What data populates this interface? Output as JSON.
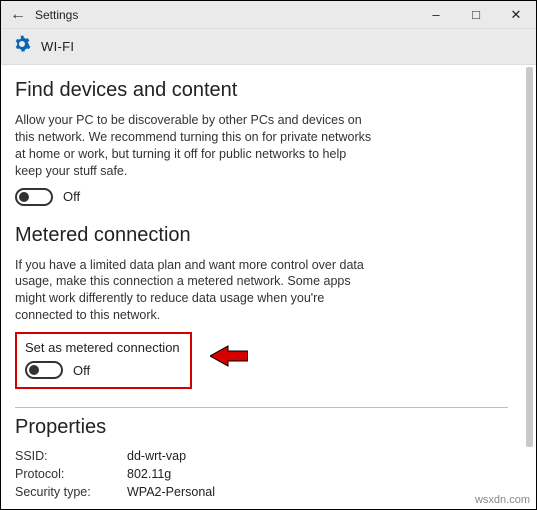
{
  "window": {
    "title": "Settings",
    "page": "WI-FI"
  },
  "sections": {
    "find": {
      "heading": "Find devices and content",
      "desc": "Allow your PC to be discoverable by other PCs and devices on this network. We recommend turning this on for private networks at home or work, but turning it off for public networks to help keep your stuff safe.",
      "toggle_state": "Off"
    },
    "metered": {
      "heading": "Metered connection",
      "desc": "If you have a limited data plan and want more control over data usage, make this connection a metered network. Some apps might work differently to reduce data usage when you're connected to this network.",
      "option_label": "Set as metered connection",
      "toggle_state": "Off"
    },
    "properties": {
      "heading": "Properties",
      "rows": [
        {
          "key": "SSID:",
          "val": "dd-wrt-vap"
        },
        {
          "key": "Protocol:",
          "val": "802.11g"
        },
        {
          "key": "Security type:",
          "val": "WPA2-Personal"
        }
      ]
    }
  },
  "watermark": "wsxdn.com"
}
